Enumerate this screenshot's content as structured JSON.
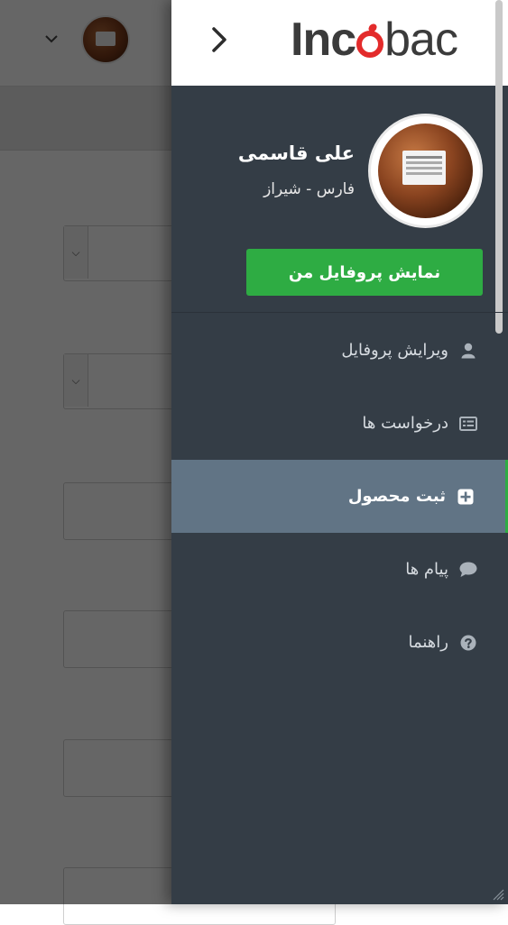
{
  "brand": {
    "logo_text_1": "Inc",
    "logo_text_2": "bac",
    "accent_color": "#2eac43",
    "logo_accent_color": "#e32b2b"
  },
  "drawer": {
    "close_icon": "chevron-right-icon",
    "user": {
      "name": "علی قاسمی",
      "location": "فارس - شیراز"
    },
    "profile_button_label": "نمایش پروفایل من",
    "menu": [
      {
        "label": "ویرایش پروفایل",
        "icon": "user-icon",
        "active": false
      },
      {
        "label": "درخواست ها",
        "icon": "list-icon",
        "active": false
      },
      {
        "label": "ثبت محصول",
        "icon": "plus-square-icon",
        "active": true
      },
      {
        "label": "پیام ها",
        "icon": "comment-icon",
        "active": false
      },
      {
        "label": "راهنما",
        "icon": "question-circle-icon",
        "active": false
      }
    ]
  },
  "background": {
    "header_dropdown_icon": "chevron-down-icon"
  }
}
